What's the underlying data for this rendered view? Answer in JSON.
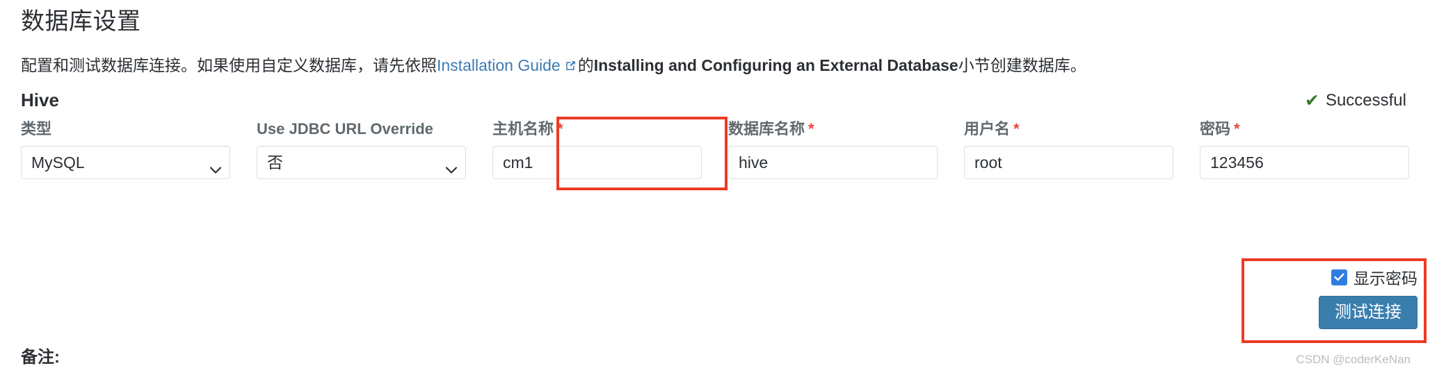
{
  "page": {
    "title": "数据库设置",
    "intro": {
      "before_link": "配置和测试数据库连接。如果使用自定义数据库，请先依照",
      "link_text": "Installation Guide",
      "link_icon": "external-link-icon",
      "after_link": "的",
      "bold_text": "Installing and Configuring an External Database",
      "tail": "小节创建数据库。"
    }
  },
  "section": {
    "title": "Hive",
    "status": {
      "icon": "check-icon",
      "label": "Successful",
      "color": "#3a7a2b"
    }
  },
  "fields": [
    {
      "label": "类型",
      "required": false,
      "type": "select",
      "value": "MySQL",
      "icon": "chevron-down-icon",
      "highlighted": false
    },
    {
      "label": "Use JDBC URL Override",
      "required": false,
      "type": "select",
      "value": "否",
      "icon": "chevron-down-icon",
      "highlighted": false
    },
    {
      "label": "主机名称",
      "required": true,
      "type": "text",
      "value": "cm1",
      "highlighted": false
    },
    {
      "label": "数据库名称",
      "required": true,
      "type": "text",
      "value": "hive",
      "highlighted": true
    },
    {
      "label": "用户名",
      "required": true,
      "type": "text",
      "value": "root",
      "highlighted": false
    },
    {
      "label": "密码",
      "required": true,
      "type": "text",
      "value": "123456",
      "highlighted": false
    }
  ],
  "required_marker": "*",
  "actions": {
    "show_password": {
      "label": "显示密码",
      "checked": true
    },
    "test_button": "测试连接"
  },
  "footer": {
    "notes_label": "备注:",
    "watermark": "CSDN @coderKeNan"
  },
  "colors": {
    "link": "#3d7ab3",
    "required": "#e8453c",
    "highlight_box": "#ee3a24",
    "success": "#3a7a2b",
    "primary_button": "#3a7eae",
    "checkbox": "#2f7de1"
  }
}
